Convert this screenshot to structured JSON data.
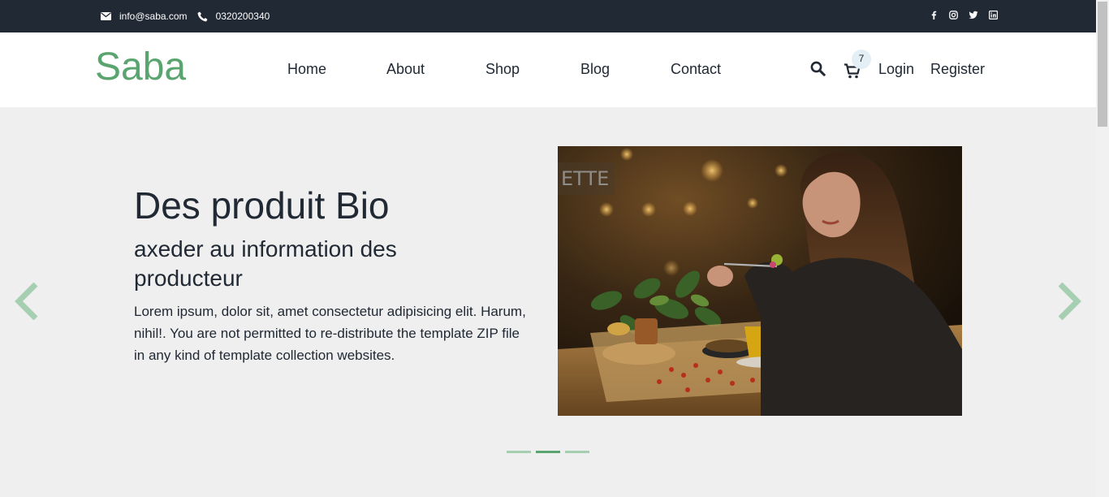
{
  "topbar": {
    "email": "info@saba.com",
    "phone": "0320200340",
    "icons": [
      "envelope-icon",
      "phone-icon",
      "facebook-icon",
      "instagram-icon",
      "twitter-icon",
      "linkedin-icon"
    ]
  },
  "navbar": {
    "logo": "Saba",
    "links": [
      "Home",
      "About",
      "Shop",
      "Blog",
      "Contact"
    ],
    "cart_count": "7",
    "login": "Login",
    "register": "Register"
  },
  "hero": {
    "title": "Des produit Bio",
    "subtitle": "axeder au information des producteur",
    "body": "Lorem ipsum, dolor sit, amet consectetur adipisicing elit. Harum, nihil!. You are not permitted to re-distribute the template ZIP file in any kind of template collection websites.",
    "slide_count": 3,
    "active_slide": 2
  },
  "colors": {
    "brand": "#5aa46f",
    "topbar": "#212934",
    "hero_bg": "#efefef",
    "arrow": "#a6cfb1"
  }
}
